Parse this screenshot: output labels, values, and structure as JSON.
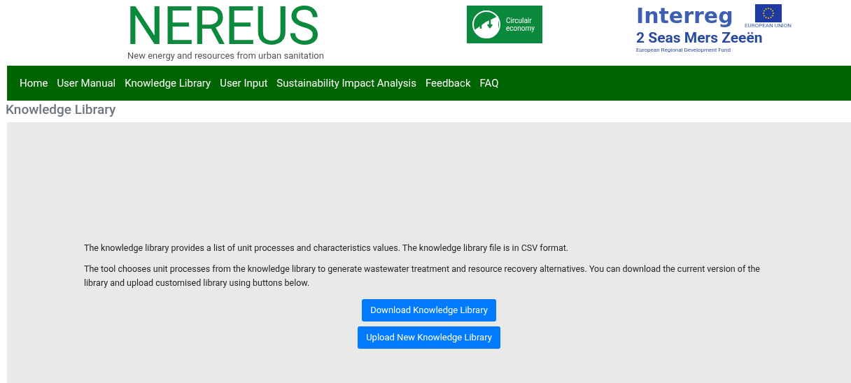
{
  "header": {
    "logo_title": "NEREUS",
    "logo_subtitle": "New energy and resources from urban sanitation",
    "badge_lines": [
      "Circulair",
      "economy"
    ],
    "partner_name": "Interreg",
    "partner_region": "2 Seas Mers Zeeën",
    "partner_flag_caption": "EUROPEAN UNION",
    "partner_fund": "European Regional Development Fund"
  },
  "nav": [
    "Home",
    "User Manual",
    "Knowledge Library",
    "User Input",
    "Sustainability Impact Analysis",
    "Feedback",
    "FAQ"
  ],
  "page_title": "Knowledge Library",
  "paragraphs": [
    "The knowledge library provides a list of unit processes and characteristics values. The knowledge library file is in CSV format.",
    "The tool chooses unit processes from the knowledge library to generate wastewater treatment and resource recovery alternatives. You can download the current version of the library and upload customised library using buttons below."
  ],
  "buttons": [
    "Download Knowledge Library",
    "Upload New Knowledge Library"
  ]
}
